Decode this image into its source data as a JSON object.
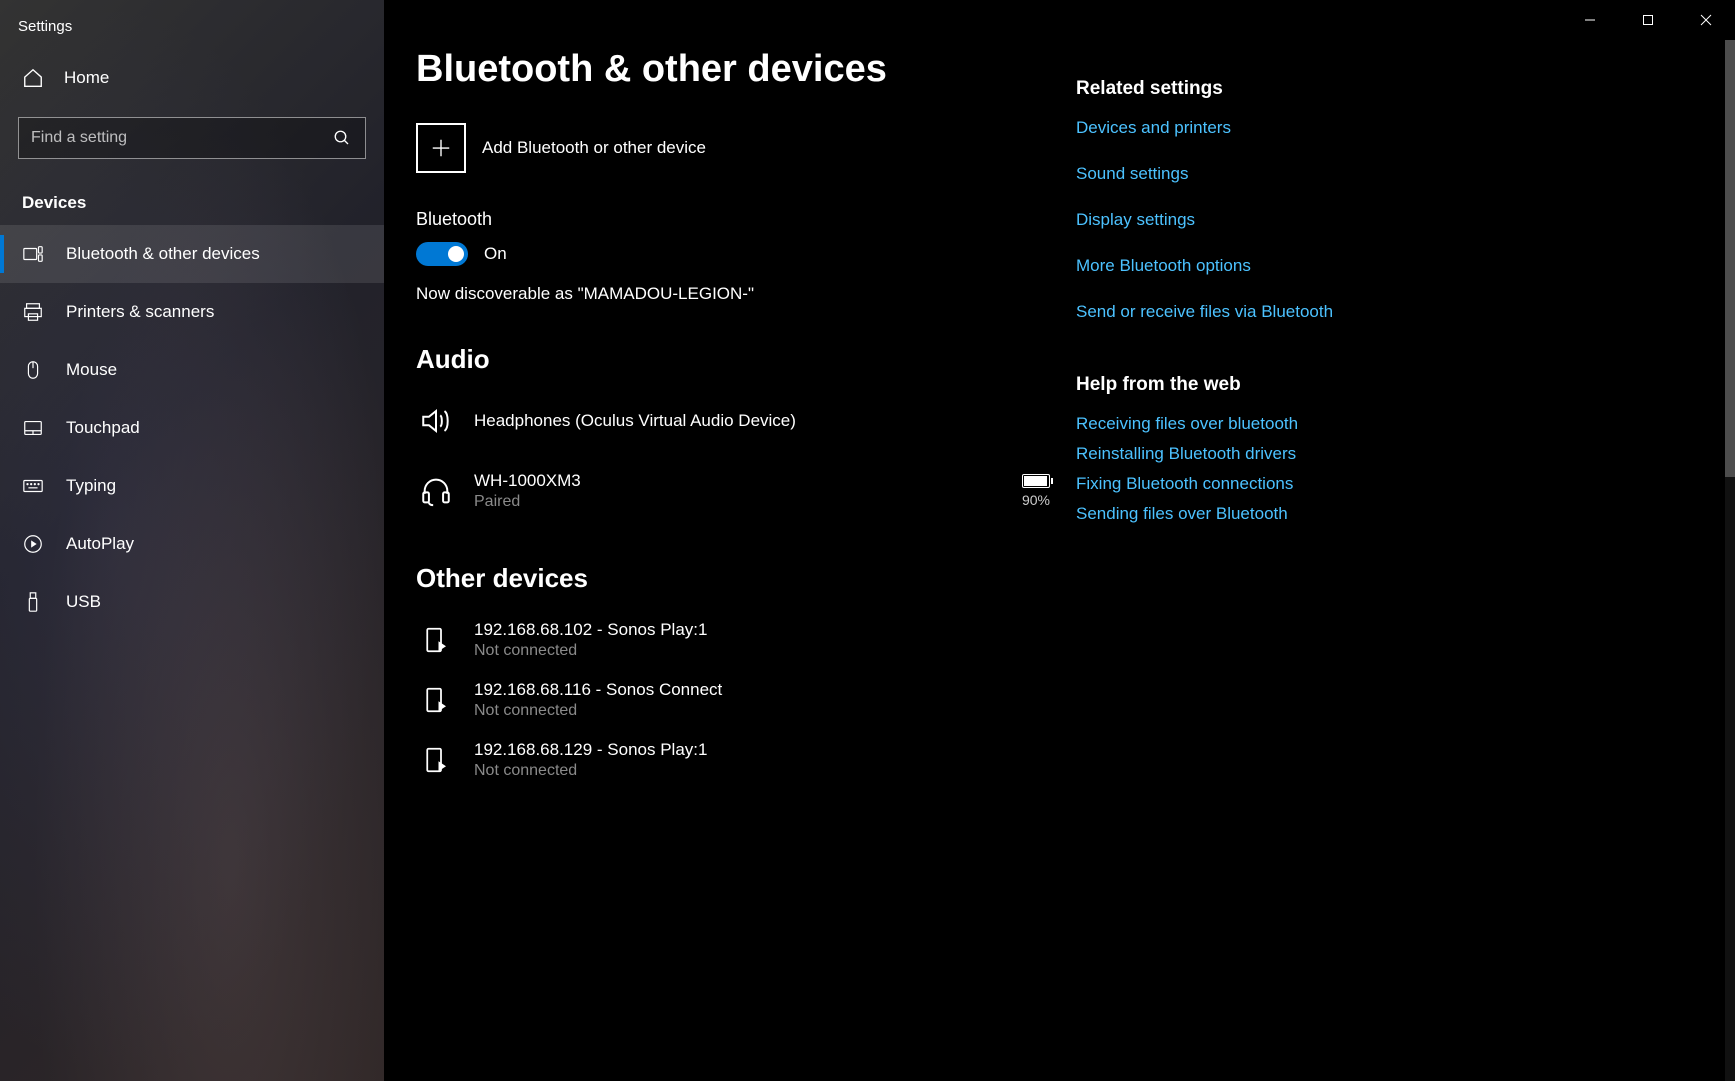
{
  "app_title": "Settings",
  "home_label": "Home",
  "search": {
    "placeholder": "Find a setting"
  },
  "sidebar_group": "Devices",
  "sidebar_items": [
    {
      "label": "Bluetooth & other devices",
      "active": true
    },
    {
      "label": "Printers & scanners"
    },
    {
      "label": "Mouse"
    },
    {
      "label": "Touchpad"
    },
    {
      "label": "Typing"
    },
    {
      "label": "AutoPlay"
    },
    {
      "label": "USB"
    }
  ],
  "page_title": "Bluetooth & other devices",
  "add_device_label": "Add Bluetooth or other device",
  "bluetooth": {
    "heading": "Bluetooth",
    "state_label": "On",
    "discoverable_text": "Now discoverable as \"MAMADOU-LEGION-\""
  },
  "audio": {
    "heading": "Audio",
    "devices": [
      {
        "name": "Headphones (Oculus Virtual Audio Device)",
        "status": "",
        "icon": "speaker",
        "battery": null
      },
      {
        "name": "WH-1000XM3",
        "status": "Paired",
        "icon": "headset",
        "battery": "90%"
      }
    ]
  },
  "other": {
    "heading": "Other devices",
    "devices": [
      {
        "name": "192.168.68.102 - Sonos Play:1",
        "status": "Not connected"
      },
      {
        "name": "192.168.68.116 - Sonos Connect",
        "status": "Not connected"
      },
      {
        "name": "192.168.68.129 - Sonos Play:1",
        "status": "Not connected"
      }
    ]
  },
  "related": {
    "heading": "Related settings",
    "links": [
      "Devices and printers",
      "Sound settings",
      "Display settings",
      "More Bluetooth options",
      "Send or receive files via Bluetooth"
    ]
  },
  "help": {
    "heading": "Help from the web",
    "links": [
      "Receiving files over bluetooth",
      "Reinstalling Bluetooth drivers",
      "Fixing Bluetooth connections",
      "Sending files over Bluetooth"
    ]
  },
  "colors": {
    "accent": "#0078d4",
    "link": "#4cc2ff"
  }
}
